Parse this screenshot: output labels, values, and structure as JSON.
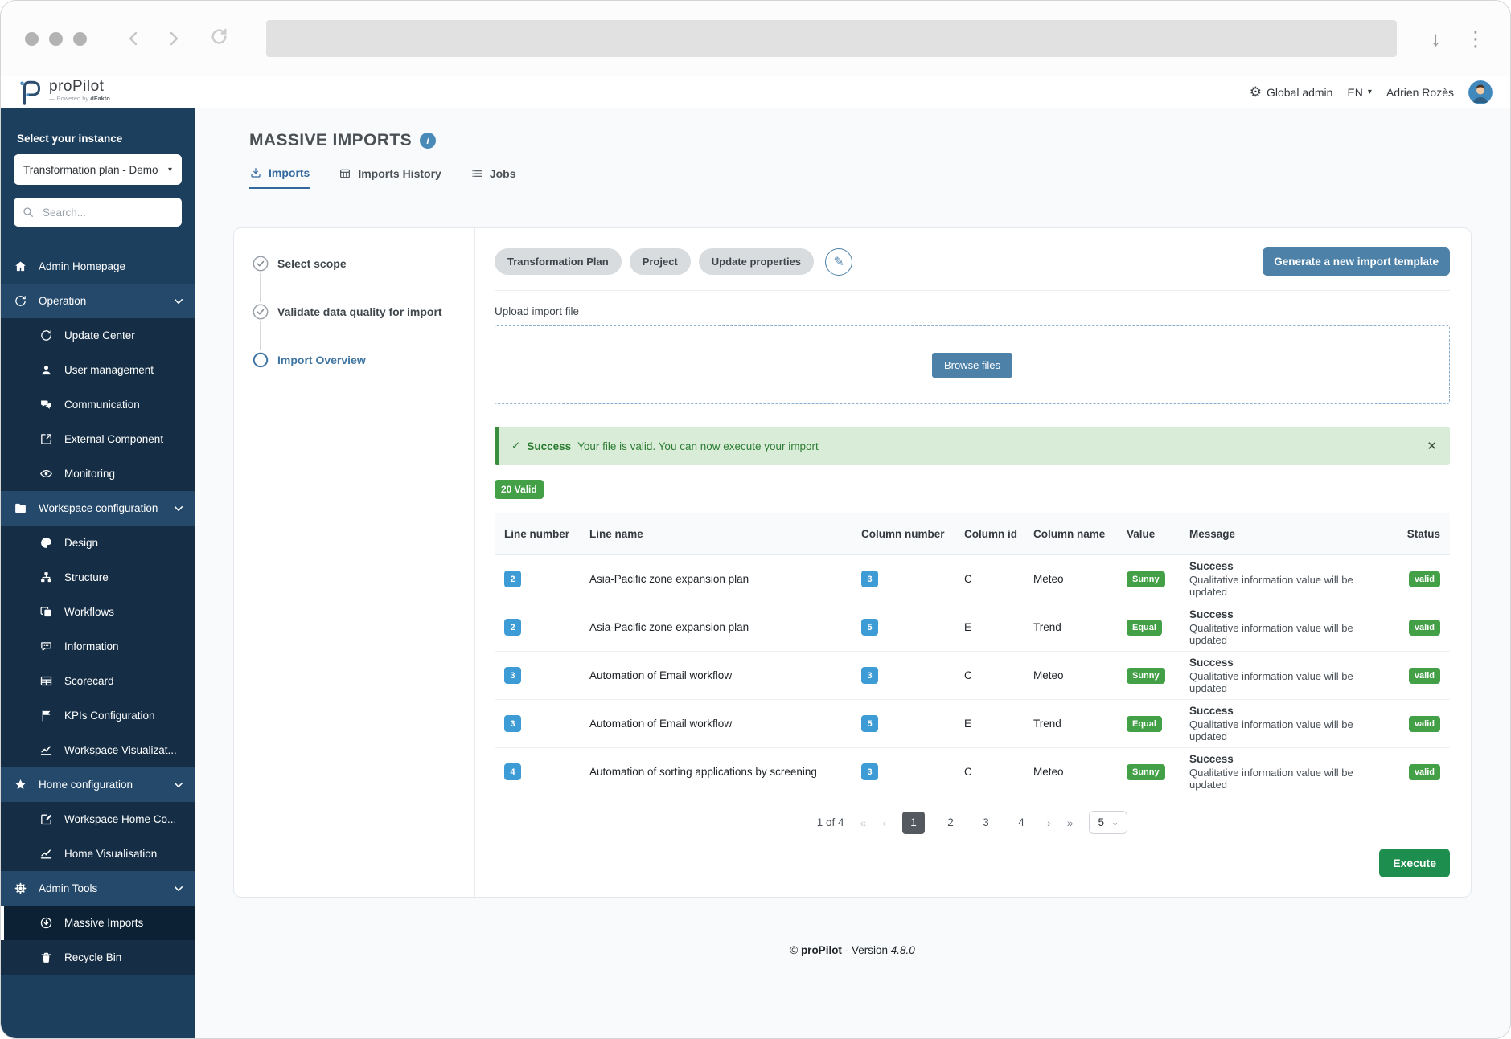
{
  "colors": {
    "sidebar_bg": "#1d3f5e",
    "sidebar_section_bg": "#24496b",
    "sidebar_sub_bg": "#152e45",
    "sidebar_active_bg": "#0c2234",
    "accent_blue": "#4d81a8",
    "tab_blue": "#33699e",
    "badge_blue": "#3d9bd5",
    "badge_green": "#43a047",
    "success_bg": "#d9ecd8",
    "success_text": "#2d7d33",
    "execute_green": "#1e8e4e"
  },
  "icons": {
    "gear": "⚙",
    "caret_down": "▾",
    "select_caret": "⌄",
    "pencil": "✎",
    "check": "✓",
    "close": "✕",
    "info": "i",
    "download_arrow": "↓",
    "kebab": "⋮",
    "first_page": "«",
    "prev_page": "‹",
    "next_page": "›",
    "last_page": "»"
  },
  "header": {
    "brand": "proPilot",
    "powered_by_prefix": "— Powered by",
    "powered_by_brand": "dFakto",
    "settings_label": "Global admin",
    "language": "EN",
    "user_name": "Adrien Rozès"
  },
  "sidebar": {
    "instance_label": "Select your instance",
    "instance_value": "Transformation plan - Demo",
    "search_placeholder": "Search...",
    "items": [
      {
        "label": "Admin Homepage"
      },
      {
        "label": "Operation"
      },
      {
        "label": "Update Center"
      },
      {
        "label": "User management"
      },
      {
        "label": "Communication"
      },
      {
        "label": "External Component"
      },
      {
        "label": "Monitoring"
      },
      {
        "label": "Workspace configuration"
      },
      {
        "label": "Design"
      },
      {
        "label": "Structure"
      },
      {
        "label": "Workflows"
      },
      {
        "label": "Information"
      },
      {
        "label": "Scorecard"
      },
      {
        "label": "KPIs Configuration"
      },
      {
        "label": "Workspace Visualizat..."
      },
      {
        "label": "Home configuration"
      },
      {
        "label": "Workspace Home Co..."
      },
      {
        "label": "Home Visualisation"
      },
      {
        "label": "Admin Tools"
      },
      {
        "label": "Massive Imports"
      },
      {
        "label": "Recycle Bin"
      }
    ]
  },
  "main": {
    "title": "MASSIVE IMPORTS",
    "tabs": [
      {
        "label": "Imports"
      },
      {
        "label": "Imports History"
      },
      {
        "label": "Jobs"
      }
    ],
    "stepper": [
      {
        "label": "Select scope",
        "state": "done"
      },
      {
        "label": "Validate data quality for import",
        "state": "done"
      },
      {
        "label": "Import Overview",
        "state": "active"
      }
    ],
    "scope_chips": [
      {
        "label": "Transformation Plan"
      },
      {
        "label": "Project"
      },
      {
        "label": "Update properties"
      }
    ],
    "template_button": "Generate a new import template",
    "upload": {
      "label": "Upload import file",
      "browse": "Browse files"
    },
    "alert": {
      "title": "Success",
      "message": "Your file is valid. You can now execute your import"
    },
    "valid_badge": "20 Valid",
    "table": {
      "columns": [
        "Line number",
        "Line name",
        "Column number",
        "Column id",
        "Column name",
        "Value",
        "Message",
        "Status"
      ],
      "rows": [
        {
          "line_number": "2",
          "line_name": "Asia-Pacific zone expansion plan",
          "column_number": "3",
          "column_id": "C",
          "column_name": "Meteo",
          "value": "Sunny",
          "message_title": "Success",
          "message_detail": "Qualitative information value will be updated",
          "status": "valid"
        },
        {
          "line_number": "2",
          "line_name": "Asia-Pacific zone expansion plan",
          "column_number": "5",
          "column_id": "E",
          "column_name": "Trend",
          "value": "Equal",
          "message_title": "Success",
          "message_detail": "Qualitative information value will be updated",
          "status": "valid"
        },
        {
          "line_number": "3",
          "line_name": "Automation of Email workflow",
          "column_number": "3",
          "column_id": "C",
          "column_name": "Meteo",
          "value": "Sunny",
          "message_title": "Success",
          "message_detail": "Qualitative information value will be updated",
          "status": "valid"
        },
        {
          "line_number": "3",
          "line_name": "Automation of Email workflow",
          "column_number": "5",
          "column_id": "E",
          "column_name": "Trend",
          "value": "Equal",
          "message_title": "Success",
          "message_detail": "Qualitative information value will be updated",
          "status": "valid"
        },
        {
          "line_number": "4",
          "line_name": "Automation of sorting applications by screening",
          "column_number": "3",
          "column_id": "C",
          "column_name": "Meteo",
          "value": "Sunny",
          "message_title": "Success",
          "message_detail": "Qualitative information value will be updated",
          "status": "valid"
        }
      ]
    },
    "pagination": {
      "summary": "1 of 4",
      "pages": [
        "1",
        "2",
        "3",
        "4"
      ],
      "page_size": "5"
    },
    "execute_button": "Execute"
  },
  "footer": {
    "prefix": "©",
    "brand": "proPilot",
    "middle": "- Version",
    "version": "4.8.0"
  }
}
